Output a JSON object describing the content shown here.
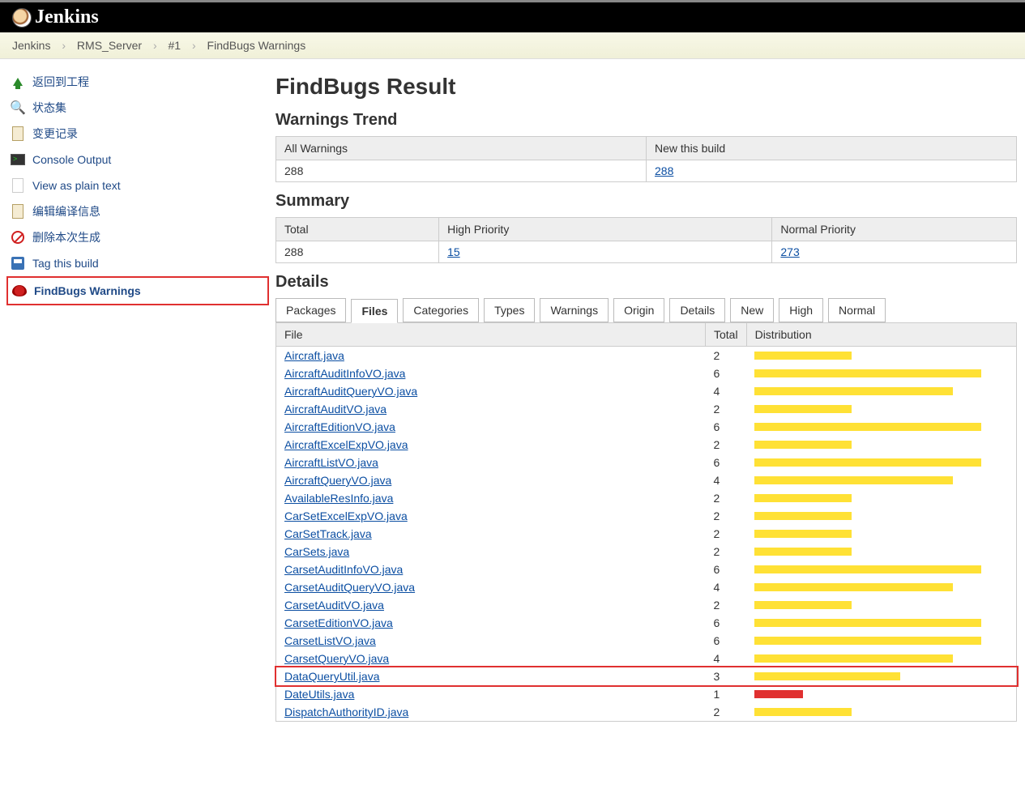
{
  "header": {
    "brand": "Jenkins"
  },
  "breadcrumb": {
    "items": [
      "Jenkins",
      "RMS_Server",
      "#1",
      "FindBugs Warnings"
    ]
  },
  "sidebar": {
    "items": [
      {
        "label": "返回到工程",
        "icon": "up-arrow-icon"
      },
      {
        "label": "状态集",
        "icon": "search-icon"
      },
      {
        "label": "变更记录",
        "icon": "document-icon"
      },
      {
        "label": "Console Output",
        "icon": "console-icon"
      },
      {
        "label": "View as plain text",
        "icon": "plaindoc-icon"
      },
      {
        "label": "编辑编译信息",
        "icon": "document-icon"
      },
      {
        "label": "删除本次生成",
        "icon": "forbidden-icon"
      },
      {
        "label": "Tag this build",
        "icon": "save-icon"
      },
      {
        "label": "FindBugs Warnings",
        "icon": "bug-icon",
        "highlighted": true
      }
    ]
  },
  "main": {
    "title": "FindBugs Result",
    "trend": {
      "heading": "Warnings Trend",
      "cols": [
        "All Warnings",
        "New this build"
      ],
      "all": "288",
      "new": "288"
    },
    "summary": {
      "heading": "Summary",
      "cols": [
        "Total",
        "High Priority",
        "Normal Priority"
      ],
      "total": "288",
      "high": "15",
      "normal": "273"
    },
    "details": {
      "heading": "Details",
      "tabs": [
        "Packages",
        "Files",
        "Categories",
        "Types",
        "Warnings",
        "Origin",
        "Details",
        "New",
        "High",
        "Normal"
      ],
      "active_tab": "Files",
      "cols": [
        "File",
        "Total",
        "Distribution"
      ],
      "rows": [
        {
          "file": "Aircraft.java",
          "total": 2,
          "yellow": 120,
          "red": 0
        },
        {
          "file": "AircraftAuditInfoVO.java",
          "total": 6,
          "yellow": 280,
          "red": 0
        },
        {
          "file": "AircraftAuditQueryVO.java",
          "total": 4,
          "yellow": 245,
          "red": 0
        },
        {
          "file": "AircraftAuditVO.java",
          "total": 2,
          "yellow": 120,
          "red": 0
        },
        {
          "file": "AircraftEditionVO.java",
          "total": 6,
          "yellow": 280,
          "red": 0
        },
        {
          "file": "AircraftExcelExpVO.java",
          "total": 2,
          "yellow": 120,
          "red": 0
        },
        {
          "file": "AircraftListVO.java",
          "total": 6,
          "yellow": 280,
          "red": 0
        },
        {
          "file": "AircraftQueryVO.java",
          "total": 4,
          "yellow": 245,
          "red": 0
        },
        {
          "file": "AvailableResInfo.java",
          "total": 2,
          "yellow": 120,
          "red": 0
        },
        {
          "file": "CarSetExcelExpVO.java",
          "total": 2,
          "yellow": 120,
          "red": 0
        },
        {
          "file": "CarSetTrack.java",
          "total": 2,
          "yellow": 120,
          "red": 0
        },
        {
          "file": "CarSets.java",
          "total": 2,
          "yellow": 120,
          "red": 0
        },
        {
          "file": "CarsetAuditInfoVO.java",
          "total": 6,
          "yellow": 280,
          "red": 0
        },
        {
          "file": "CarsetAuditQueryVO.java",
          "total": 4,
          "yellow": 245,
          "red": 0
        },
        {
          "file": "CarsetAuditVO.java",
          "total": 2,
          "yellow": 120,
          "red": 0
        },
        {
          "file": "CarsetEditionVO.java",
          "total": 6,
          "yellow": 280,
          "red": 0
        },
        {
          "file": "CarsetListVO.java",
          "total": 6,
          "yellow": 280,
          "red": 0
        },
        {
          "file": "CarsetQueryVO.java",
          "total": 4,
          "yellow": 245,
          "red": 0
        },
        {
          "file": "DataQueryUtil.java",
          "total": 3,
          "yellow": 180,
          "red": 0,
          "highlight": true
        },
        {
          "file": "DateUtils.java",
          "total": 1,
          "yellow": 0,
          "red": 60
        },
        {
          "file": "DispatchAuthorityID.java",
          "total": 2,
          "yellow": 120,
          "red": 0
        }
      ]
    }
  }
}
